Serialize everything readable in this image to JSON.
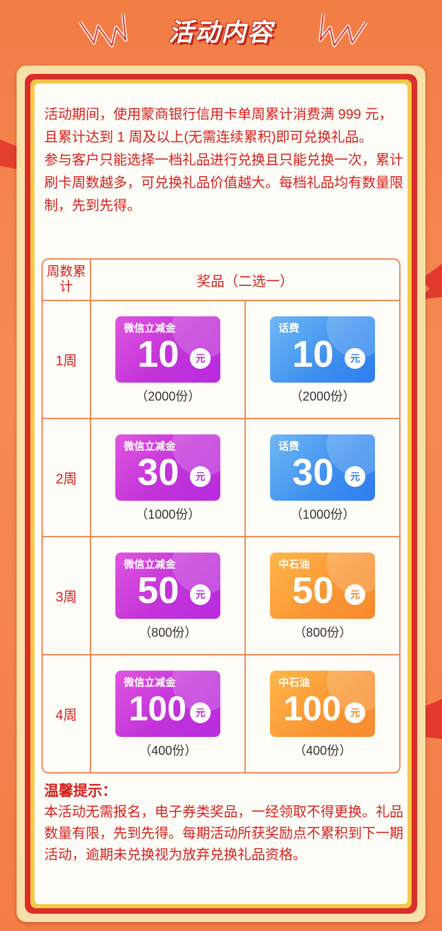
{
  "header": {
    "title": "活动内容"
  },
  "intro": {
    "paragraph1": "活动期间，使用蒙商银行信用卡单周累计消费满 999 元，且累计达到 1 周及以上(无需连续累积)即可兑换礼品。",
    "paragraph2": "参与客户只能选择一档礼品进行兑换且只能兑换一次，累计刷卡周数越多，可兑换礼品价值越大。每档礼品均有数量限制，先到先得。"
  },
  "table": {
    "header_week": "周数累计",
    "header_prize": "奖品（二选一）",
    "rows": [
      {
        "week": "1周",
        "left": {
          "name": "微信立减金",
          "amount": "10",
          "unit": "元",
          "qty": "（2000份）"
        },
        "right": {
          "name": "话费",
          "amount": "10",
          "unit": "元",
          "qty": "（2000份）"
        }
      },
      {
        "week": "2周",
        "left": {
          "name": "微信立减金",
          "amount": "30",
          "unit": "元",
          "qty": "（1000份）"
        },
        "right": {
          "name": "话费",
          "amount": "30",
          "unit": "元",
          "qty": "（1000份）"
        }
      },
      {
        "week": "3周",
        "left": {
          "name": "微信立减金",
          "amount": "50",
          "unit": "元",
          "qty": "（800份）"
        },
        "right": {
          "name": "中石油",
          "amount": "50",
          "unit": "元",
          "qty": "（800份）"
        }
      },
      {
        "week": "4周",
        "left": {
          "name": "微信立减金",
          "amount": "100",
          "unit": "元",
          "qty": "（400份）"
        },
        "right": {
          "name": "中石油",
          "amount": "100",
          "unit": "元",
          "qty": "（400份）"
        }
      }
    ]
  },
  "tips": {
    "title": "温馨提示：",
    "body": "本活动无需报名，电子券类奖品，一经领取不得更换。礼品数量有限，先到先得。每期活动所获奖励点不累积到下一期活动，逾期未兑换视为放弃兑换礼品资格。"
  },
  "colors": {
    "background": "#f58b53",
    "accent_red": "#d3211f",
    "frame_gold": "#f5c84a",
    "wechat_coupon": "#c233d8",
    "phone_coupon": "#3d8ff0",
    "oil_coupon": "#f99534"
  }
}
